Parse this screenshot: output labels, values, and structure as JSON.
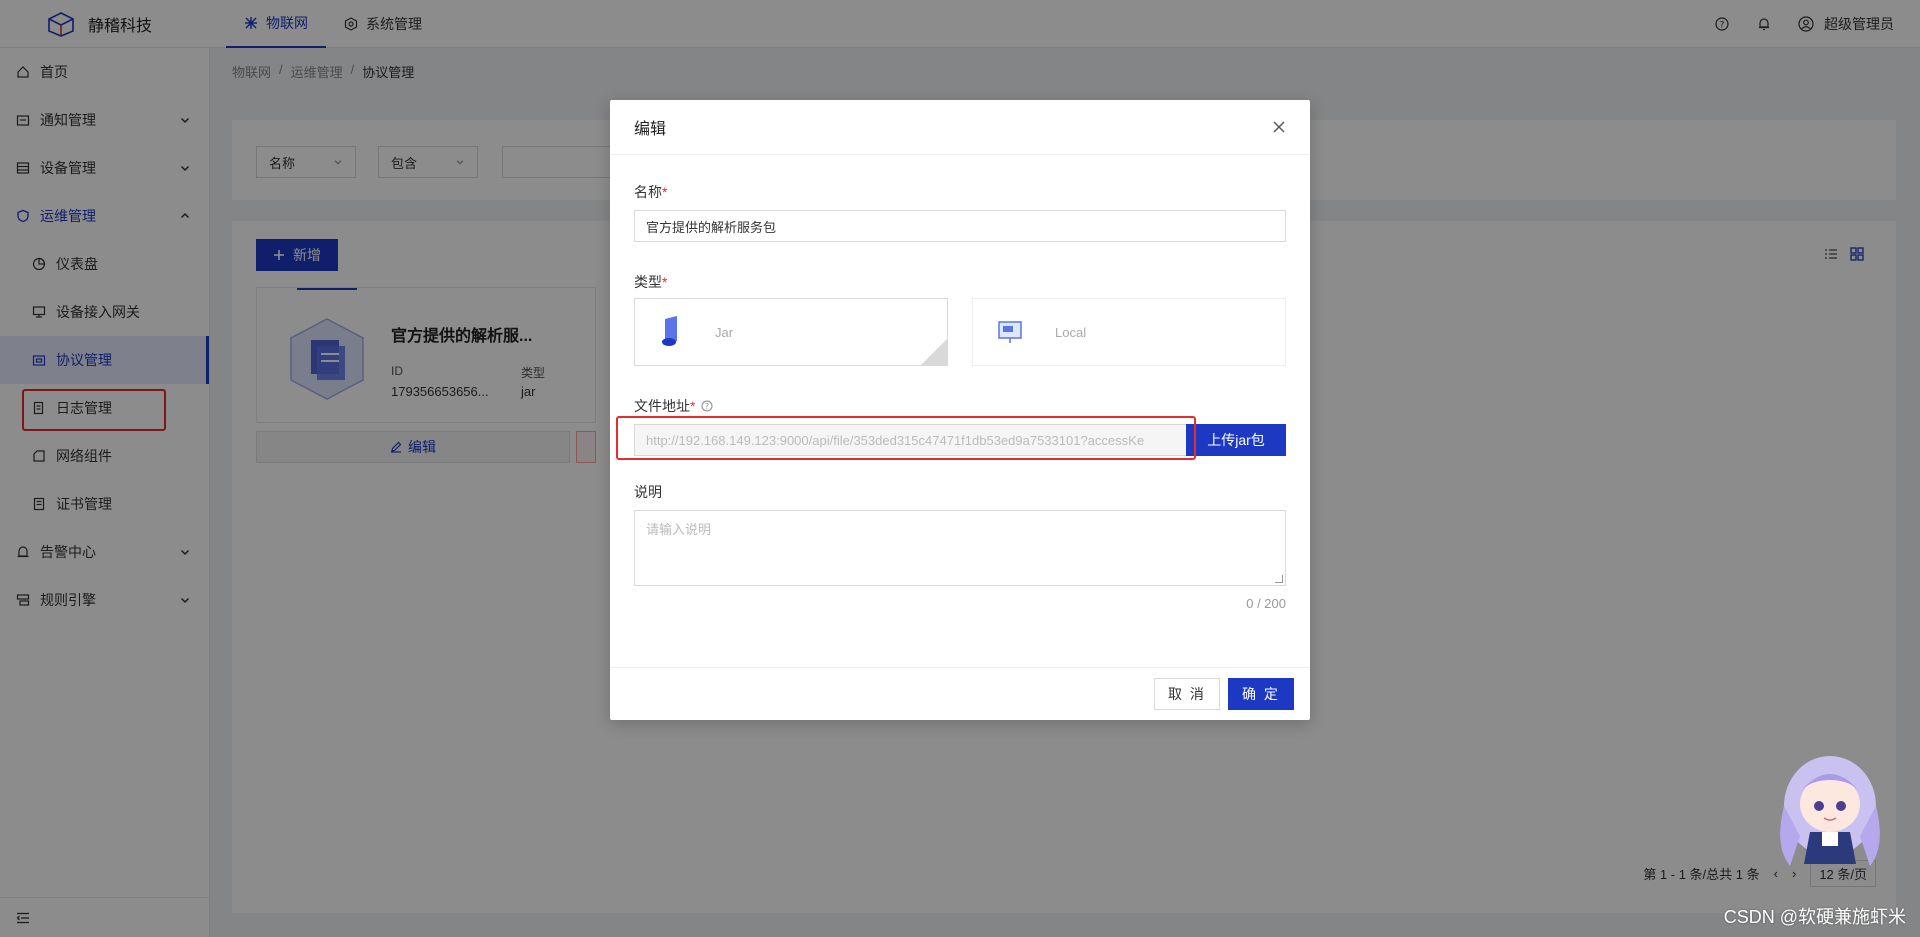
{
  "header": {
    "brand": "静稽科技",
    "nav": [
      {
        "label": "物联网",
        "active": true,
        "icon": "iot-icon"
      },
      {
        "label": "系统管理",
        "active": false,
        "icon": "settings-box-icon"
      }
    ],
    "user": "超级管理员"
  },
  "sidebar": {
    "items": [
      {
        "label": "首页",
        "icon": "home-icon",
        "has_arrow": false
      },
      {
        "label": "通知管理",
        "icon": "notice-icon",
        "has_arrow": true
      },
      {
        "label": "设备管理",
        "icon": "device-icon",
        "has_arrow": true
      },
      {
        "label": "运维管理",
        "icon": "shield-icon",
        "has_arrow": true,
        "open": true
      }
    ],
    "sub_items": [
      {
        "label": "仪表盘",
        "icon": "dashboard-icon"
      },
      {
        "label": "设备接入网关",
        "icon": "monitor-icon"
      },
      {
        "label": "协议管理",
        "icon": "protocol-icon",
        "selected": true
      },
      {
        "label": "日志管理",
        "icon": "log-icon"
      },
      {
        "label": "网络组件",
        "icon": "network-icon"
      },
      {
        "label": "证书管理",
        "icon": "certificate-icon"
      }
    ],
    "bottom_items": [
      {
        "label": "告警中心",
        "icon": "alarm-icon",
        "has_arrow": true
      },
      {
        "label": "规则引擎",
        "icon": "rule-icon",
        "has_arrow": true
      }
    ]
  },
  "breadcrumb": [
    "物联网",
    "运维管理",
    "协议管理"
  ],
  "search": {
    "field": "名称",
    "operator": "包含"
  },
  "list": {
    "add_label": "新增",
    "card": {
      "title": "官方提供的解析服...",
      "id_label": "ID",
      "id_value": "179356653656...",
      "type_label": "类型",
      "type_value": "jar",
      "edit_label": "编辑"
    },
    "pager": {
      "summary": "第 1 - 1 条/总共 1 条",
      "page_size": "12 条/页"
    }
  },
  "modal": {
    "title": "编辑",
    "name_label": "名称",
    "name_value": "官方提供的解析服务包",
    "type_label": "类型",
    "type_options": [
      "Jar",
      "Local"
    ],
    "url_label": "文件地址",
    "url_value": "http://192.168.149.123:9000/api/file/353ded315c47471f1db53ed9a7533101?accessKe",
    "upload_label": "上传jar包",
    "desc_label": "说明",
    "desc_placeholder": "请输入说明",
    "counter": "0 / 200",
    "cancel_label": "取 消",
    "ok_label": "确 定"
  },
  "watermark": "CSDN @软硬兼施虾米",
  "colors": {
    "primary": "#1d39c4",
    "danger": "#e52d2d"
  }
}
